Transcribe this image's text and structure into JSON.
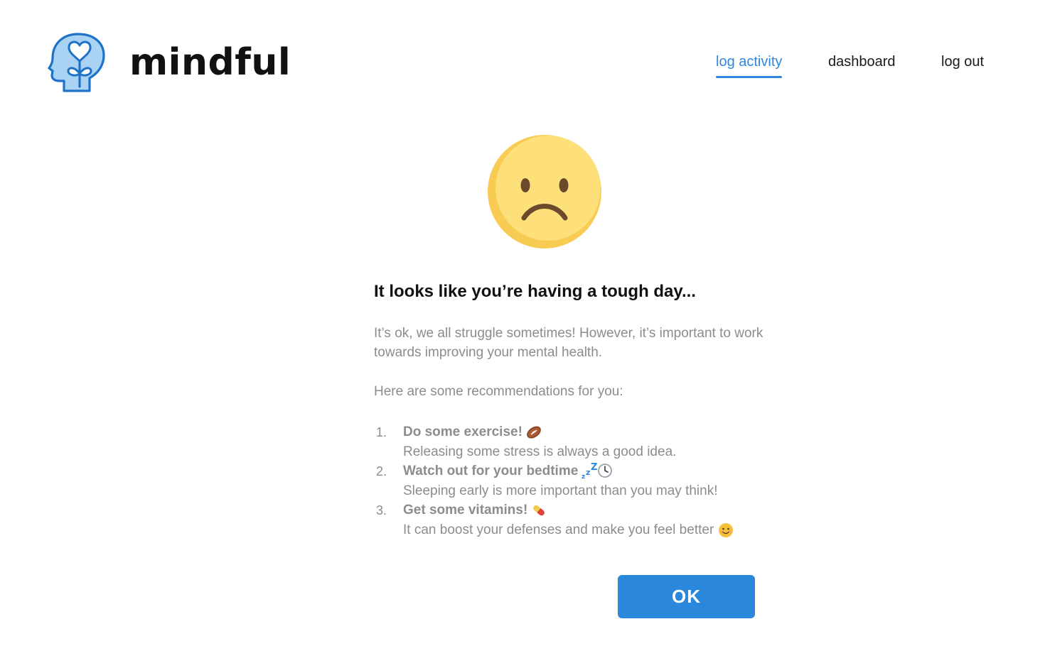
{
  "brand": {
    "name": "mindful",
    "logo_icon": "head-heart-plant-icon",
    "accent": "#2f86dd"
  },
  "nav": {
    "items": [
      {
        "label": "log activity",
        "active": true
      },
      {
        "label": "dashboard",
        "active": false
      },
      {
        "label": "log out",
        "active": false
      }
    ]
  },
  "mood": {
    "icon": "sad-face-icon",
    "color": "#fcd96b"
  },
  "message": {
    "headline": "It looks like you’re having a tough day...",
    "intro": "It’s ok, we all struggle sometimes! However, it’s important to work towards improving your mental health.",
    "recommend_intro": "Here are some recommendations for you:"
  },
  "recommendations": [
    {
      "number": "1.",
      "title": "Do some exercise!",
      "icon": "football-icon",
      "description": "Releasing some stress is always a good idea."
    },
    {
      "number": "2.",
      "title": "Watch out for your bedtime",
      "icon": "zzz-clock-icon",
      "description": "Sleeping early is more important than you may think!"
    },
    {
      "number": "3.",
      "title": "Get some vitamins!",
      "icon": "pill-icon",
      "description": "It can boost your defenses and make you feel better",
      "trailing_icon": "smiling-face-icon"
    }
  ],
  "actions": {
    "ok_label": "OK",
    "ok_color": "#2b87db"
  }
}
